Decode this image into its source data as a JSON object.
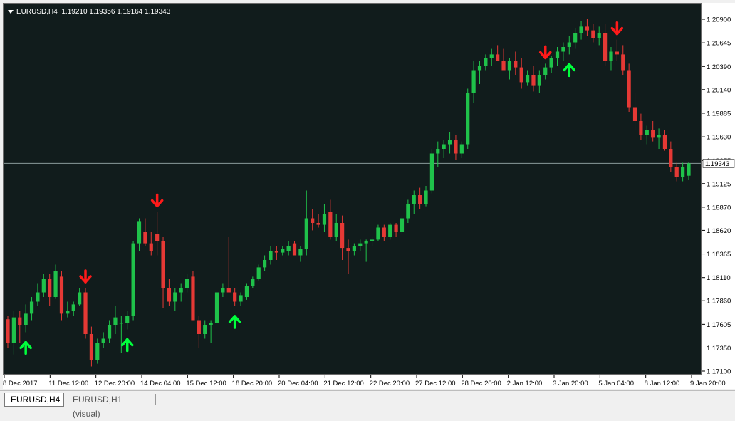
{
  "header": {
    "symbol": "EURUSD,H4",
    "ohlc": "1.19210 1.19356 1.19164 1.19343"
  },
  "tabs": [
    {
      "label": "EURUSD,H4",
      "active": true
    },
    {
      "label": "EURUSD,H1 (visual)",
      "active": false
    }
  ],
  "colors": {
    "background": "#111c1c",
    "bull": "#1fc24a",
    "bear": "#e53935",
    "signal_up": "#00ff3c",
    "signal_down": "#ff1a1a",
    "price_line": "#8a9a9a"
  },
  "chart_data": {
    "type": "candlestick",
    "symbol": "EURUSD",
    "timeframe": "H4",
    "ylim": [
      1.1705,
      1.2105
    ],
    "price_ticks": [
      1.209,
      1.20645,
      1.2039,
      1.2014,
      1.19885,
      1.1963,
      1.19375,
      1.19125,
      1.1887,
      1.1862,
      1.18365,
      1.1811,
      1.1786,
      1.17605,
      1.1735,
      1.171
    ],
    "price_tick_labels": [
      "1.20900",
      "1.20645",
      "1.20390",
      "1.20140",
      "1.19885",
      "1.19630",
      "1.19375",
      "1.19125",
      "1.18870",
      "1.18620",
      "1.18365",
      "1.18110",
      "1.17860",
      "1.17605",
      "1.17350",
      "1.17100"
    ],
    "current_price": 1.19343,
    "current_price_label": "1.19343",
    "time_labels": [
      "8 Dec 2017",
      "11 Dec 12:00",
      "12 Dec 20:00",
      "14 Dec 04:00",
      "15 Dec 12:00",
      "18 Dec 20:00",
      "20 Dec 04:00",
      "21 Dec 12:00",
      "22 Dec 20:00",
      "27 Dec 12:00",
      "28 Dec 20:00",
      "2 Jan 12:00",
      "3 Jan 20:00",
      "5 Jan 04:00",
      "8 Jan 12:00",
      "9 Jan 20:00"
    ],
    "candles": [
      [
        1.1766,
        1.177,
        1.1735,
        1.174
      ],
      [
        1.174,
        1.1775,
        1.1728,
        1.1768
      ],
      [
        1.1768,
        1.1775,
        1.174,
        1.176
      ],
      [
        1.176,
        1.1782,
        1.1752,
        1.1772
      ],
      [
        1.1772,
        1.179,
        1.1765,
        1.1785
      ],
      [
        1.1785,
        1.1805,
        1.178,
        1.1795
      ],
      [
        1.1795,
        1.1815,
        1.179,
        1.181
      ],
      [
        1.181,
        1.1815,
        1.178,
        1.179
      ],
      [
        1.179,
        1.1825,
        1.1788,
        1.1818
      ],
      [
        1.1812,
        1.1818,
        1.1765,
        1.1772
      ],
      [
        1.1772,
        1.1785,
        1.1768,
        1.1775
      ],
      [
        1.1775,
        1.1785,
        1.177,
        1.1782
      ],
      [
        1.1782,
        1.18,
        1.178,
        1.1795
      ],
      [
        1.1795,
        1.18,
        1.1745,
        1.175
      ],
      [
        1.175,
        1.1758,
        1.1715,
        1.1722
      ],
      [
        1.1722,
        1.1745,
        1.1718,
        1.174
      ],
      [
        1.174,
        1.1752,
        1.1735,
        1.1745
      ],
      [
        1.1745,
        1.1765,
        1.174,
        1.176
      ],
      [
        1.176,
        1.178,
        1.175,
        1.1768
      ],
      [
        1.1762,
        1.177,
        1.173,
        1.1762
      ],
      [
        1.1762,
        1.1775,
        1.1755,
        1.177
      ],
      [
        1.177,
        1.185,
        1.1765,
        1.1848
      ],
      [
        1.1848,
        1.1875,
        1.184,
        1.1872
      ],
      [
        1.186,
        1.1875,
        1.1845,
        1.1848
      ],
      [
        1.1848,
        1.186,
        1.1835,
        1.184
      ],
      [
        1.1858,
        1.1882,
        1.1835,
        1.185
      ],
      [
        1.185,
        1.1855,
        1.1778,
        1.18
      ],
      [
        1.18,
        1.181,
        1.178,
        1.1785
      ],
      [
        1.1785,
        1.18,
        1.1775,
        1.1795
      ],
      [
        1.1795,
        1.1805,
        1.1785,
        1.18
      ],
      [
        1.18,
        1.1815,
        1.1795,
        1.181
      ],
      [
        1.1812,
        1.1818,
        1.1782,
        1.1765
      ],
      [
        1.1765,
        1.177,
        1.1735,
        1.175
      ],
      [
        1.175,
        1.1765,
        1.1745,
        1.176
      ],
      [
        1.176,
        1.1765,
        1.174,
        1.1762
      ],
      [
        1.1762,
        1.1798,
        1.176,
        1.1795
      ],
      [
        1.1795,
        1.1805,
        1.179,
        1.18
      ],
      [
        1.18,
        1.1855,
        1.1795,
        1.1795
      ],
      [
        1.1795,
        1.18,
        1.178,
        1.1785
      ],
      [
        1.1785,
        1.1795,
        1.178,
        1.1792
      ],
      [
        1.179,
        1.1805,
        1.1787,
        1.1802
      ],
      [
        1.1802,
        1.1812,
        1.18,
        1.181
      ],
      [
        1.181,
        1.1825,
        1.1808,
        1.1822
      ],
      [
        1.1822,
        1.1835,
        1.1818,
        1.183
      ],
      [
        1.183,
        1.1845,
        1.1825,
        1.184
      ],
      [
        1.184,
        1.1845,
        1.183,
        1.1838
      ],
      [
        1.1838,
        1.1845,
        1.1835,
        1.1842
      ],
      [
        1.184,
        1.185,
        1.1835,
        1.1845
      ],
      [
        1.1848,
        1.185,
        1.1835,
        1.1835
      ],
      [
        1.1835,
        1.1845,
        1.1828,
        1.1842
      ],
      [
        1.1842,
        1.1905,
        1.1835,
        1.1875
      ],
      [
        1.1875,
        1.1885,
        1.1862,
        1.187
      ],
      [
        1.187,
        1.188,
        1.1865,
        1.1868
      ],
      [
        1.1868,
        1.189,
        1.186,
        1.188
      ],
      [
        1.1882,
        1.1895,
        1.1852,
        1.1855
      ],
      [
        1.1855,
        1.188,
        1.185,
        1.187
      ],
      [
        1.187,
        1.1878,
        1.183,
        1.1843
      ],
      [
        1.1843,
        1.1852,
        1.1815,
        1.184
      ],
      [
        1.184,
        1.1848,
        1.1835,
        1.1845
      ],
      [
        1.1845,
        1.1852,
        1.184,
        1.1848
      ],
      [
        1.1848,
        1.1852,
        1.1828,
        1.185
      ],
      [
        1.185,
        1.1855,
        1.1845,
        1.1852
      ],
      [
        1.1852,
        1.1868,
        1.185,
        1.1865
      ],
      [
        1.1865,
        1.1868,
        1.185,
        1.1855
      ],
      [
        1.1855,
        1.187,
        1.1852,
        1.1868
      ],
      [
        1.1868,
        1.187,
        1.1855,
        1.186
      ],
      [
        1.186,
        1.1878,
        1.1858,
        1.1875
      ],
      [
        1.1875,
        1.1895,
        1.187,
        1.189
      ],
      [
        1.189,
        1.1905,
        1.188,
        1.19
      ],
      [
        1.19,
        1.1908,
        1.1885,
        1.189
      ],
      [
        1.189,
        1.191,
        1.1888,
        1.1905
      ],
      [
        1.1905,
        1.195,
        1.1902,
        1.1945
      ],
      [
        1.1945,
        1.1958,
        1.193,
        1.195
      ],
      [
        1.195,
        1.196,
        1.194,
        1.1955
      ],
      [
        1.1955,
        1.1968,
        1.1945,
        1.196
      ],
      [
        1.196,
        1.1965,
        1.1938,
        1.1945
      ],
      [
        1.1945,
        1.1958,
        1.194,
        1.1955
      ],
      [
        1.1955,
        1.2015,
        1.195,
        1.201
      ],
      [
        1.201,
        1.2045,
        1.2,
        1.2035
      ],
      [
        1.2035,
        1.2045,
        1.202,
        1.204
      ],
      [
        1.204,
        1.2052,
        1.2035,
        1.2048
      ],
      [
        1.2048,
        1.2058,
        1.204,
        1.2052
      ],
      [
        1.2052,
        1.2062,
        1.2045,
        1.2045
      ],
      [
        1.2045,
        1.2058,
        1.2038,
        1.2035
      ],
      [
        1.2035,
        1.2048,
        1.2025,
        1.2045
      ],
      [
        1.2045,
        1.2055,
        1.203,
        1.2038
      ],
      [
        1.2038,
        1.2048,
        1.2015,
        1.2022
      ],
      [
        1.2022,
        1.2035,
        1.2018,
        1.203
      ],
      [
        1.203,
        1.204,
        1.2012,
        1.2018
      ],
      [
        1.2018,
        1.2035,
        1.201,
        1.203
      ],
      [
        1.203,
        1.2042,
        1.2025,
        1.2038
      ],
      [
        1.2038,
        1.205,
        1.2032,
        1.2048
      ],
      [
        1.2048,
        1.206,
        1.204,
        1.2055
      ],
      [
        1.2055,
        1.2065,
        1.2045,
        1.206
      ],
      [
        1.206,
        1.2072,
        1.2052,
        1.2065
      ],
      [
        1.2065,
        1.208,
        1.2058,
        1.2075
      ],
      [
        1.2075,
        1.2088,
        1.2068,
        1.2082
      ],
      [
        1.2082,
        1.209,
        1.2072,
        1.2078
      ],
      [
        1.2078,
        1.2085,
        1.2065,
        1.207
      ],
      [
        1.207,
        1.2082,
        1.2062,
        1.2075
      ],
      [
        1.2075,
        1.2085,
        1.204,
        1.2045
      ],
      [
        1.2045,
        1.206,
        1.2035,
        1.2055
      ],
      [
        1.2055,
        1.2068,
        1.2045,
        1.2052
      ],
      [
        1.2052,
        1.2062,
        1.203,
        1.2035
      ],
      [
        1.2035,
        1.2042,
        1.199,
        1.1995
      ],
      [
        1.1995,
        1.201,
        1.197,
        1.198
      ],
      [
        1.198,
        1.1988,
        1.196,
        1.1965
      ],
      [
        1.1965,
        1.1975,
        1.1955,
        1.197
      ],
      [
        1.197,
        1.198,
        1.1958,
        1.1962
      ],
      [
        1.1962,
        1.1972,
        1.195,
        1.1965
      ],
      [
        1.1965,
        1.197,
        1.1948,
        1.195
      ],
      [
        1.195,
        1.1958,
        1.1925,
        1.193
      ],
      [
        1.193,
        1.1935,
        1.1915,
        1.192
      ],
      [
        1.192,
        1.1935,
        1.1915,
        1.193
      ],
      [
        1.1921,
        1.19356,
        1.19164,
        1.19343
      ]
    ],
    "signals": [
      {
        "candle": 3,
        "dir": "up"
      },
      {
        "candle": 13,
        "dir": "down"
      },
      {
        "candle": 20,
        "dir": "up"
      },
      {
        "candle": 25,
        "dir": "down"
      },
      {
        "candle": 38,
        "dir": "up"
      },
      {
        "candle": 90,
        "dir": "down"
      },
      {
        "candle": 94,
        "dir": "up"
      },
      {
        "candle": 102,
        "dir": "down"
      }
    ]
  }
}
